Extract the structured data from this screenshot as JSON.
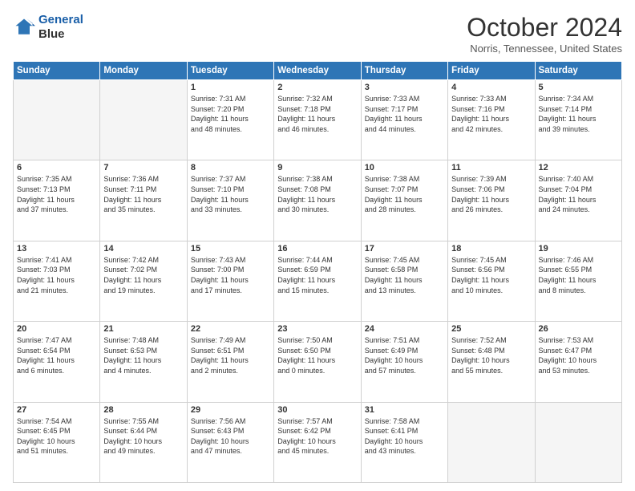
{
  "header": {
    "logo_line1": "General",
    "logo_line2": "Blue",
    "title": "October 2024",
    "location": "Norris, Tennessee, United States"
  },
  "weekdays": [
    "Sunday",
    "Monday",
    "Tuesday",
    "Wednesday",
    "Thursday",
    "Friday",
    "Saturday"
  ],
  "weeks": [
    [
      {
        "day": "",
        "info": ""
      },
      {
        "day": "",
        "info": ""
      },
      {
        "day": "1",
        "info": "Sunrise: 7:31 AM\nSunset: 7:20 PM\nDaylight: 11 hours\nand 48 minutes."
      },
      {
        "day": "2",
        "info": "Sunrise: 7:32 AM\nSunset: 7:18 PM\nDaylight: 11 hours\nand 46 minutes."
      },
      {
        "day": "3",
        "info": "Sunrise: 7:33 AM\nSunset: 7:17 PM\nDaylight: 11 hours\nand 44 minutes."
      },
      {
        "day": "4",
        "info": "Sunrise: 7:33 AM\nSunset: 7:16 PM\nDaylight: 11 hours\nand 42 minutes."
      },
      {
        "day": "5",
        "info": "Sunrise: 7:34 AM\nSunset: 7:14 PM\nDaylight: 11 hours\nand 39 minutes."
      }
    ],
    [
      {
        "day": "6",
        "info": "Sunrise: 7:35 AM\nSunset: 7:13 PM\nDaylight: 11 hours\nand 37 minutes."
      },
      {
        "day": "7",
        "info": "Sunrise: 7:36 AM\nSunset: 7:11 PM\nDaylight: 11 hours\nand 35 minutes."
      },
      {
        "day": "8",
        "info": "Sunrise: 7:37 AM\nSunset: 7:10 PM\nDaylight: 11 hours\nand 33 minutes."
      },
      {
        "day": "9",
        "info": "Sunrise: 7:38 AM\nSunset: 7:08 PM\nDaylight: 11 hours\nand 30 minutes."
      },
      {
        "day": "10",
        "info": "Sunrise: 7:38 AM\nSunset: 7:07 PM\nDaylight: 11 hours\nand 28 minutes."
      },
      {
        "day": "11",
        "info": "Sunrise: 7:39 AM\nSunset: 7:06 PM\nDaylight: 11 hours\nand 26 minutes."
      },
      {
        "day": "12",
        "info": "Sunrise: 7:40 AM\nSunset: 7:04 PM\nDaylight: 11 hours\nand 24 minutes."
      }
    ],
    [
      {
        "day": "13",
        "info": "Sunrise: 7:41 AM\nSunset: 7:03 PM\nDaylight: 11 hours\nand 21 minutes."
      },
      {
        "day": "14",
        "info": "Sunrise: 7:42 AM\nSunset: 7:02 PM\nDaylight: 11 hours\nand 19 minutes."
      },
      {
        "day": "15",
        "info": "Sunrise: 7:43 AM\nSunset: 7:00 PM\nDaylight: 11 hours\nand 17 minutes."
      },
      {
        "day": "16",
        "info": "Sunrise: 7:44 AM\nSunset: 6:59 PM\nDaylight: 11 hours\nand 15 minutes."
      },
      {
        "day": "17",
        "info": "Sunrise: 7:45 AM\nSunset: 6:58 PM\nDaylight: 11 hours\nand 13 minutes."
      },
      {
        "day": "18",
        "info": "Sunrise: 7:45 AM\nSunset: 6:56 PM\nDaylight: 11 hours\nand 10 minutes."
      },
      {
        "day": "19",
        "info": "Sunrise: 7:46 AM\nSunset: 6:55 PM\nDaylight: 11 hours\nand 8 minutes."
      }
    ],
    [
      {
        "day": "20",
        "info": "Sunrise: 7:47 AM\nSunset: 6:54 PM\nDaylight: 11 hours\nand 6 minutes."
      },
      {
        "day": "21",
        "info": "Sunrise: 7:48 AM\nSunset: 6:53 PM\nDaylight: 11 hours\nand 4 minutes."
      },
      {
        "day": "22",
        "info": "Sunrise: 7:49 AM\nSunset: 6:51 PM\nDaylight: 11 hours\nand 2 minutes."
      },
      {
        "day": "23",
        "info": "Sunrise: 7:50 AM\nSunset: 6:50 PM\nDaylight: 11 hours\nand 0 minutes."
      },
      {
        "day": "24",
        "info": "Sunrise: 7:51 AM\nSunset: 6:49 PM\nDaylight: 10 hours\nand 57 minutes."
      },
      {
        "day": "25",
        "info": "Sunrise: 7:52 AM\nSunset: 6:48 PM\nDaylight: 10 hours\nand 55 minutes."
      },
      {
        "day": "26",
        "info": "Sunrise: 7:53 AM\nSunset: 6:47 PM\nDaylight: 10 hours\nand 53 minutes."
      }
    ],
    [
      {
        "day": "27",
        "info": "Sunrise: 7:54 AM\nSunset: 6:45 PM\nDaylight: 10 hours\nand 51 minutes."
      },
      {
        "day": "28",
        "info": "Sunrise: 7:55 AM\nSunset: 6:44 PM\nDaylight: 10 hours\nand 49 minutes."
      },
      {
        "day": "29",
        "info": "Sunrise: 7:56 AM\nSunset: 6:43 PM\nDaylight: 10 hours\nand 47 minutes."
      },
      {
        "day": "30",
        "info": "Sunrise: 7:57 AM\nSunset: 6:42 PM\nDaylight: 10 hours\nand 45 minutes."
      },
      {
        "day": "31",
        "info": "Sunrise: 7:58 AM\nSunset: 6:41 PM\nDaylight: 10 hours\nand 43 minutes."
      },
      {
        "day": "",
        "info": ""
      },
      {
        "day": "",
        "info": ""
      }
    ]
  ]
}
